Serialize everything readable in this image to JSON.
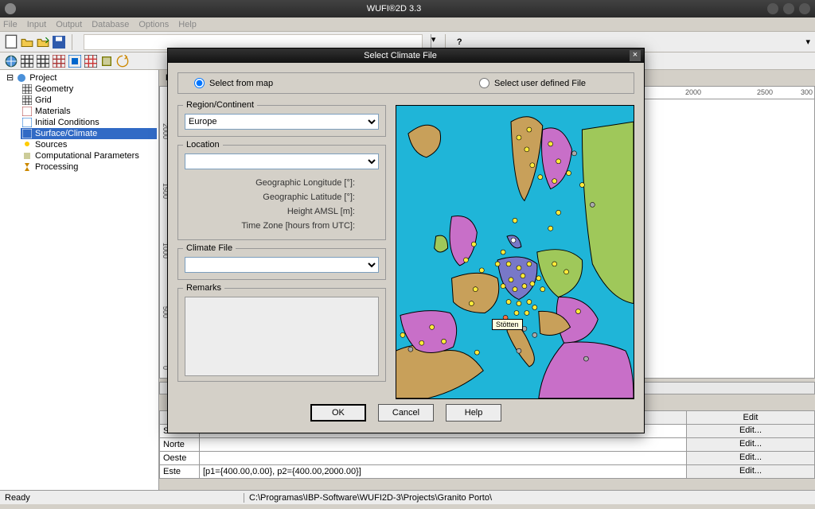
{
  "window": {
    "title": "WUFI®2D 3.3"
  },
  "menu": {
    "file": "File",
    "input": "Input",
    "output": "Output",
    "database": "Database",
    "options": "Options",
    "help": "Help"
  },
  "tree": {
    "root": "Project",
    "items": [
      "Geometry",
      "Grid",
      "Materials",
      "Initial Conditions",
      "Surface/Climate",
      "Sources",
      "Computational Parameters",
      "Processing"
    ],
    "selected_index": 4
  },
  "content": {
    "label": "Proj",
    "ruler_x": [
      "2000",
      "2500",
      "300"
    ],
    "ruler_y": [
      "0",
      "500",
      "1000",
      "1500",
      "2000"
    ]
  },
  "table": {
    "head_btn": "Edit",
    "rows": [
      {
        "name": "Sul",
        "desc": "",
        "btn": "Edit..."
      },
      {
        "name": "Norte",
        "desc": "",
        "btn": "Edit..."
      },
      {
        "name": "Oeste",
        "desc": "",
        "btn": "Edit..."
      },
      {
        "name": "Este",
        "desc": "[p1={400.00,0.00}, p2={400.00,2000.00}]",
        "btn": "Edit..."
      }
    ]
  },
  "status": {
    "ready": "Ready",
    "path": "C:\\Programas\\IBP-Software\\WUFI2D-3\\Projects\\Granito Porto\\"
  },
  "dialog": {
    "title": "Select Climate File",
    "radio1": "Select from map",
    "radio2": "Select user defined File",
    "region_legend": "Region/Continent",
    "region_value": "Europe",
    "location_legend": "Location",
    "location_value": "",
    "meta": {
      "lon": "Geographic Longitude [°]:",
      "lat": "Geographic Latitude [°]:",
      "amsl": "Height AMSL [m]:",
      "tz": "Time Zone [hours from UTC]:"
    },
    "climatefile_legend": "Climate File",
    "remarks_legend": "Remarks",
    "tooltip": "Stötten",
    "buttons": {
      "ok": "OK",
      "cancel": "Cancel",
      "help": "Help"
    }
  }
}
